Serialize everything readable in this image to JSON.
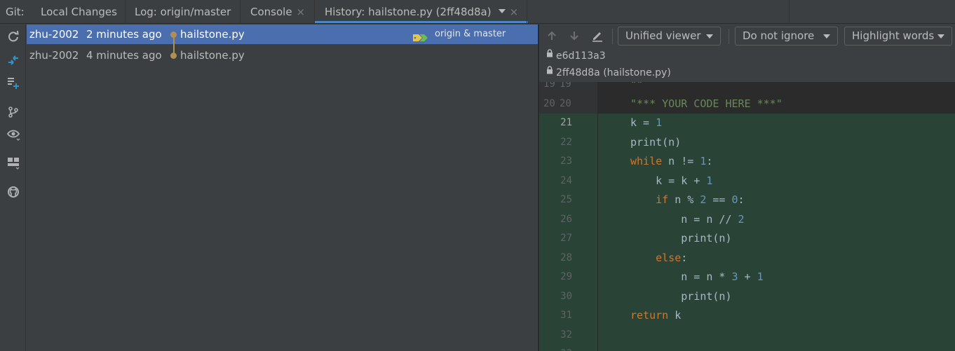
{
  "tabbar": {
    "git_label": "Git:",
    "tabs": [
      {
        "label": "Local Changes"
      },
      {
        "label": "Log: origin/master"
      },
      {
        "label": "Console"
      },
      {
        "label": "History: hailstone.py (2ff48d8a)"
      }
    ],
    "close_glyph": "×"
  },
  "left_toolbar": {
    "icons": [
      "refresh-icon",
      "pull-icon",
      "update-project-icon",
      "branch-icon",
      "eye-icon",
      "layout-icon",
      "github-icon"
    ]
  },
  "commits": [
    {
      "author": "zhu-2002",
      "time": "2 minutes ago",
      "message": "hailstone.py",
      "refs": "origin & master"
    },
    {
      "author": "zhu-2002",
      "time": "4 minutes ago",
      "message": "hailstone.py",
      "refs": ""
    }
  ],
  "diff": {
    "toolbar": {
      "viewer": "Unified viewer",
      "ignore": "Do not ignore",
      "highlight": "Highlight words"
    },
    "revisions": [
      "e6d113a3",
      "2ff48d8a (hailstone.py)"
    ],
    "lines": [
      {
        "old": "19",
        "new": "19",
        "code": "\"\"\""
      },
      {
        "old": "20",
        "new": "20",
        "code": "\"*** YOUR CODE HERE ***\""
      },
      {
        "old": "",
        "new": "21",
        "code": "k = 1"
      },
      {
        "old": "",
        "new": "22",
        "code": "print(n)"
      },
      {
        "old": "",
        "new": "23",
        "code": "while n != 1:"
      },
      {
        "old": "",
        "new": "24",
        "code": "    k = k + 1"
      },
      {
        "old": "",
        "new": "25",
        "code": "    if n % 2 == 0:"
      },
      {
        "old": "",
        "new": "26",
        "code": "        n = n // 2"
      },
      {
        "old": "",
        "new": "27",
        "code": "        print(n)"
      },
      {
        "old": "",
        "new": "28",
        "code": "    else:"
      },
      {
        "old": "",
        "new": "29",
        "code": "        n = n * 3 + 1"
      },
      {
        "old": "",
        "new": "30",
        "code": "        print(n)"
      },
      {
        "old": "",
        "new": "31",
        "code": "return k"
      },
      {
        "old": "",
        "new": "32",
        "code": ""
      },
      {
        "old": "",
        "new": "33",
        "code": ""
      }
    ]
  },
  "colors": {
    "selection": "#4b6eaf",
    "added_bg": "#294436",
    "keyword": "#cc7832",
    "number": "#6897bb",
    "string": "#6a8759",
    "graph": "#b08f54"
  }
}
